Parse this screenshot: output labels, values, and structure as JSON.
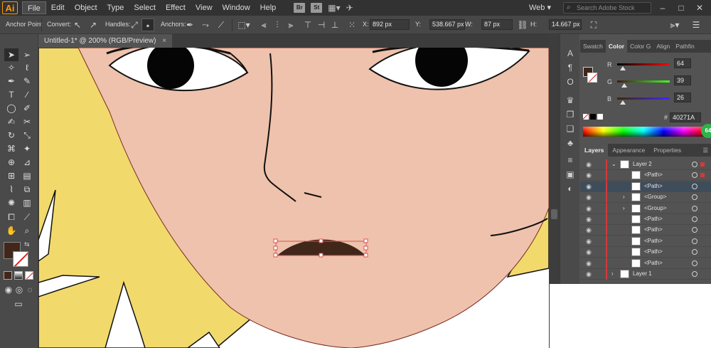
{
  "menubar": {
    "app_logo": "Ai",
    "items": [
      "File",
      "Edit",
      "Object",
      "Type",
      "Select",
      "Effect",
      "View",
      "Window",
      "Help"
    ],
    "badges": [
      "Br",
      "St"
    ],
    "workspace": "Web",
    "search_placeholder": "Search Adobe Stock"
  },
  "controlbar": {
    "tool_name": "Anchor Point",
    "convert_label": "Convert:",
    "handles_label": "Handles:",
    "anchors_label": "Anchors:",
    "x_label": "X:",
    "x_value": "892 px",
    "y_label": "Y:",
    "y_value": "538.667 px",
    "w_label": "W:",
    "w_value": "87 px",
    "h_label": "H:",
    "h_value": "14.667 px"
  },
  "document": {
    "tab_title": "Untitled-1* @ 200% (RGB/Preview)",
    "close_glyph": "×"
  },
  "color_panel": {
    "tabs": [
      "Swatch",
      "Color",
      "Color G",
      "Align",
      "Pathfin"
    ],
    "active_tab": "Color",
    "r_label": "R",
    "r_value": "64",
    "g_label": "G",
    "g_value": "39",
    "b_label": "B",
    "b_value": "26",
    "hex_label": "#",
    "hex_value": "40271A",
    "fill_color": "#40271a",
    "spectrum_badge": "64"
  },
  "layers_panel": {
    "tabs": [
      "Layers",
      "Appearance",
      "Properties"
    ],
    "active_tab": "Layers",
    "rows": [
      {
        "name": "Layer 2",
        "level": 0,
        "expanded": true,
        "target": true
      },
      {
        "name": "<Path>",
        "level": 1,
        "expanded": false,
        "target": true
      },
      {
        "name": "<Path>",
        "level": 1,
        "expanded": false,
        "target": false
      },
      {
        "name": "<Group>",
        "level": 1,
        "expanded": false,
        "target": false
      },
      {
        "name": "<Group>",
        "level": 1,
        "expanded": false,
        "target": false
      },
      {
        "name": "<Path>",
        "level": 1,
        "expanded": false,
        "target": false
      },
      {
        "name": "<Path>",
        "level": 1,
        "expanded": false,
        "target": false
      },
      {
        "name": "<Path>",
        "level": 1,
        "expanded": false,
        "target": false
      },
      {
        "name": "<Path>",
        "level": 1,
        "expanded": false,
        "target": false
      },
      {
        "name": "<Path>",
        "level": 1,
        "expanded": false,
        "target": false
      },
      {
        "name": "Layer 1",
        "level": 0,
        "expanded": false,
        "target": false
      }
    ],
    "selected_row": 2
  },
  "colors": {
    "skin": "#eec2ac",
    "hair": "#f2d96c",
    "mouth": "#40271a",
    "layer_highlight": "#d23a3a",
    "selection_outline": "#e05050"
  },
  "icons": {
    "search": "search-icon",
    "eye": "eye-icon",
    "chevron_down": "chevron-down-icon",
    "chevron_right": "chevron-right-icon"
  }
}
